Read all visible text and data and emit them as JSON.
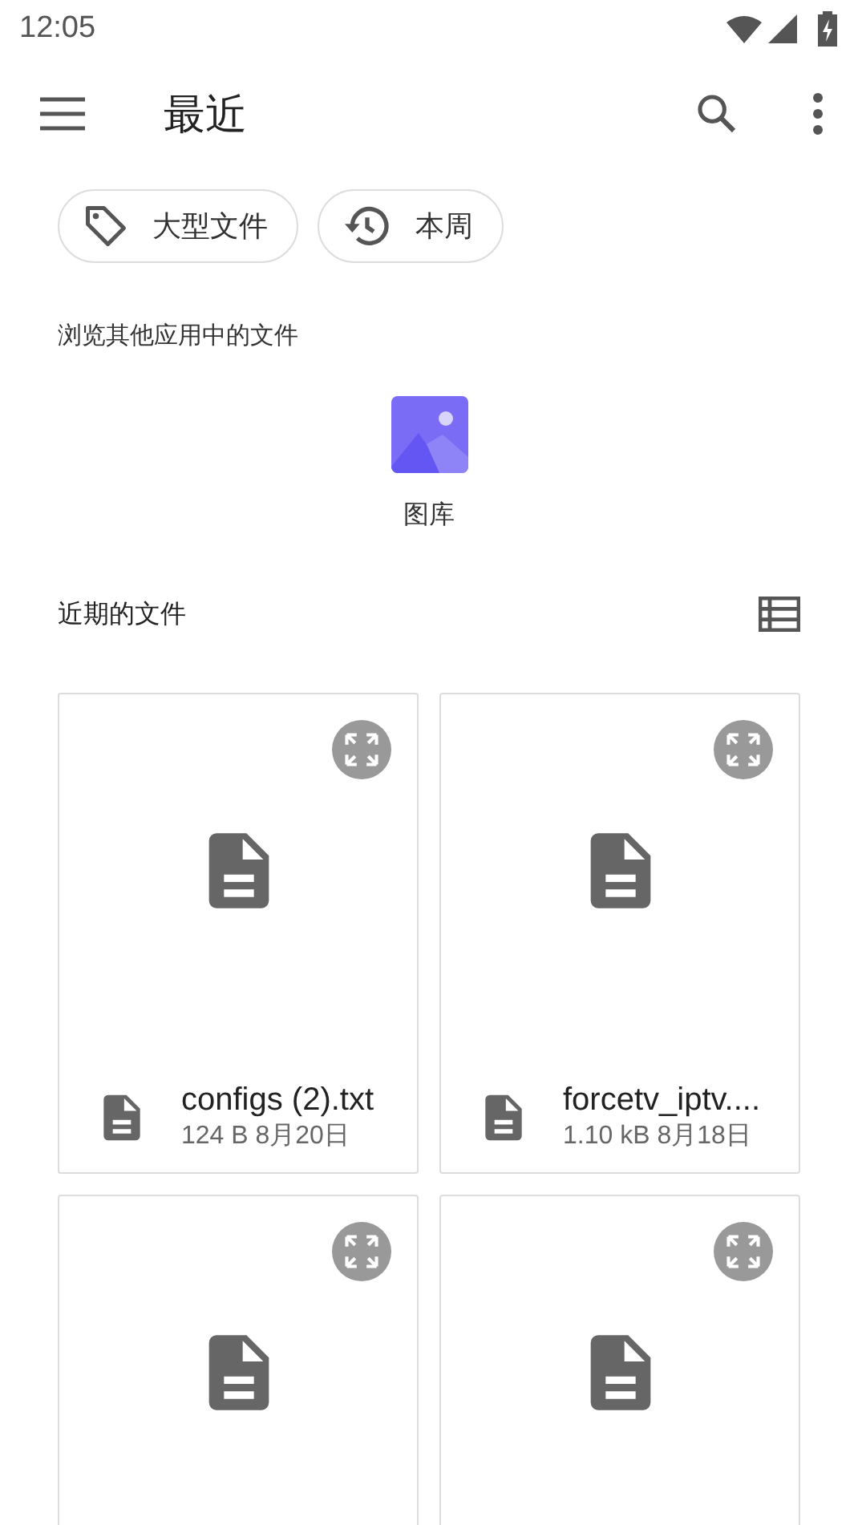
{
  "status_bar": {
    "time": "12:05"
  },
  "app_bar": {
    "title": "最近"
  },
  "chips": [
    {
      "kind": "tag",
      "label": "大型文件"
    },
    {
      "kind": "history",
      "label": "本周"
    }
  ],
  "apps_section": {
    "title": "浏览其他应用中的文件",
    "apps": [
      {
        "label": "图库"
      }
    ]
  },
  "recent_section": {
    "title": "近期的文件"
  },
  "files": [
    {
      "kind": "document",
      "name": "configs (2).txt",
      "meta": "124 B 8月20日"
    },
    {
      "kind": "document",
      "name": "forcetv_iptv....",
      "meta": "1.10 kB 8月18日"
    },
    {
      "kind": "document"
    },
    {
      "kind": "document"
    }
  ]
}
